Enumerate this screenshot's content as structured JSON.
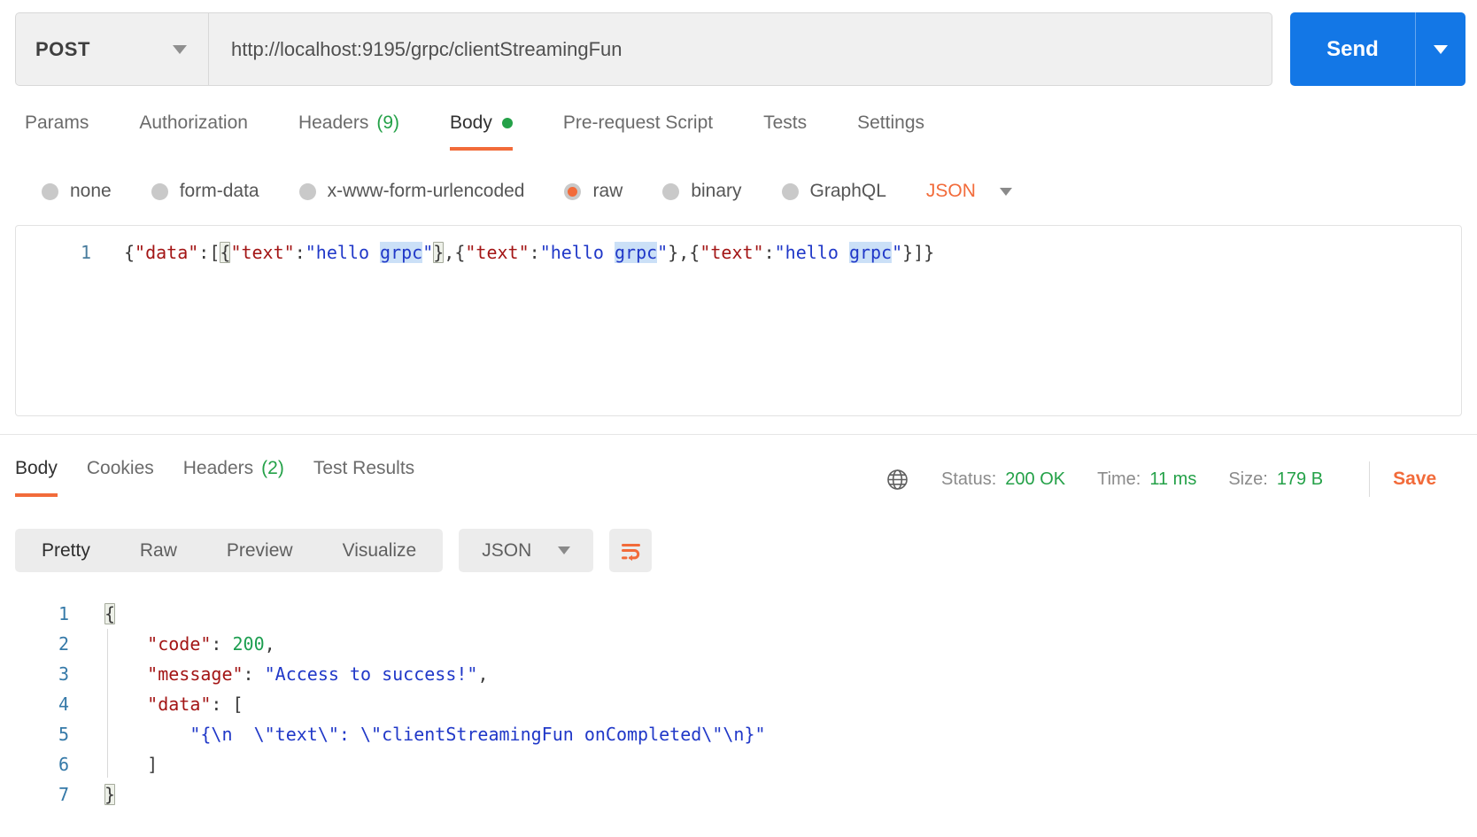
{
  "request": {
    "method": "POST",
    "url": "http://localhost:9195/grpc/clientStreamingFun",
    "send_label": "Send",
    "tabs": [
      {
        "label": "Params"
      },
      {
        "label": "Authorization"
      },
      {
        "label": "Headers",
        "count": "(9)"
      },
      {
        "label": "Body",
        "active": true,
        "dot": true
      },
      {
        "label": "Pre-request Script"
      },
      {
        "label": "Tests"
      },
      {
        "label": "Settings"
      }
    ],
    "body_types": [
      "none",
      "form-data",
      "x-www-form-urlencoded",
      "raw",
      "binary",
      "GraphQL"
    ],
    "selected_body_type": "raw",
    "language": "JSON",
    "editor": {
      "line_number": "1",
      "tokens": [
        {
          "t": "{",
          "c": "brace"
        },
        {
          "t": "\"data\"",
          "c": "key"
        },
        {
          "t": ":",
          "c": "punc"
        },
        {
          "t": "[",
          "c": "brace"
        },
        {
          "t": "{",
          "c": "brace",
          "box": true
        },
        {
          "t": "\"text\"",
          "c": "key"
        },
        {
          "t": ":",
          "c": "punc"
        },
        {
          "t": "\"hello ",
          "c": "str"
        },
        {
          "t": "grpc",
          "c": "str",
          "hl": true
        },
        {
          "t": "\"",
          "c": "str"
        },
        {
          "t": "}",
          "c": "brace",
          "box": true
        },
        {
          "t": ",",
          "c": "punc"
        },
        {
          "t": "{",
          "c": "brace"
        },
        {
          "t": "\"text\"",
          "c": "key"
        },
        {
          "t": ":",
          "c": "punc"
        },
        {
          "t": "\"hello ",
          "c": "str"
        },
        {
          "t": "grpc",
          "c": "str",
          "hl": true
        },
        {
          "t": "\"",
          "c": "str"
        },
        {
          "t": "}",
          "c": "brace"
        },
        {
          "t": ",",
          "c": "punc"
        },
        {
          "t": "{",
          "c": "brace"
        },
        {
          "t": "\"text\"",
          "c": "key"
        },
        {
          "t": ":",
          "c": "punc"
        },
        {
          "t": "\"hello ",
          "c": "str"
        },
        {
          "t": "grpc",
          "c": "str",
          "hl": true
        },
        {
          "t": "\"",
          "c": "str"
        },
        {
          "t": "}",
          "c": "brace"
        },
        {
          "t": "]",
          "c": "brace"
        },
        {
          "t": "}",
          "c": "brace"
        }
      ]
    }
  },
  "response": {
    "tabs": [
      {
        "label": "Body",
        "active": true
      },
      {
        "label": "Cookies"
      },
      {
        "label": "Headers",
        "count": "(2)"
      },
      {
        "label": "Test Results"
      }
    ],
    "meta": {
      "status_label": "Status:",
      "status_value": "200 OK",
      "time_label": "Time:",
      "time_value": "11 ms",
      "size_label": "Size:",
      "size_value": "179 B",
      "save_label": "Save"
    },
    "views": [
      "Pretty",
      "Raw",
      "Preview",
      "Visualize"
    ],
    "active_view": "Pretty",
    "language": "JSON",
    "editor": {
      "lines": [
        {
          "no": "1",
          "tokens": [
            {
              "t": "{",
              "c": "brace",
              "box": true
            }
          ]
        },
        {
          "no": "2",
          "tokens": [
            {
              "t": "    ",
              "c": "ws"
            },
            {
              "t": "\"code\"",
              "c": "key"
            },
            {
              "t": ": ",
              "c": "punc"
            },
            {
              "t": "200",
              "c": "num"
            },
            {
              "t": ",",
              "c": "punc"
            }
          ]
        },
        {
          "no": "3",
          "tokens": [
            {
              "t": "    ",
              "c": "ws"
            },
            {
              "t": "\"message\"",
              "c": "key"
            },
            {
              "t": ": ",
              "c": "punc"
            },
            {
              "t": "\"Access to success!\"",
              "c": "str"
            },
            {
              "t": ",",
              "c": "punc"
            }
          ]
        },
        {
          "no": "4",
          "tokens": [
            {
              "t": "    ",
              "c": "ws"
            },
            {
              "t": "\"data\"",
              "c": "key"
            },
            {
              "t": ": ",
              "c": "punc"
            },
            {
              "t": "[",
              "c": "brace"
            }
          ]
        },
        {
          "no": "5",
          "tokens": [
            {
              "t": "        ",
              "c": "ws"
            },
            {
              "t": "\"{\\n  \\\"text\\\": \\\"clientStreamingFun onCompleted\\\"\\n}\"",
              "c": "str"
            }
          ]
        },
        {
          "no": "6",
          "tokens": [
            {
              "t": "    ",
              "c": "ws"
            },
            {
              "t": "]",
              "c": "brace"
            }
          ]
        },
        {
          "no": "7",
          "tokens": [
            {
              "t": "}",
              "c": "brace",
              "box": true
            }
          ]
        }
      ]
    }
  },
  "colors": {
    "accent_orange": "#f26b3a",
    "send_blue": "#1377e6",
    "success_green": "#24a148",
    "code_key": "#a31515",
    "code_string": "#2038c8",
    "code_number": "#1d9e50"
  }
}
